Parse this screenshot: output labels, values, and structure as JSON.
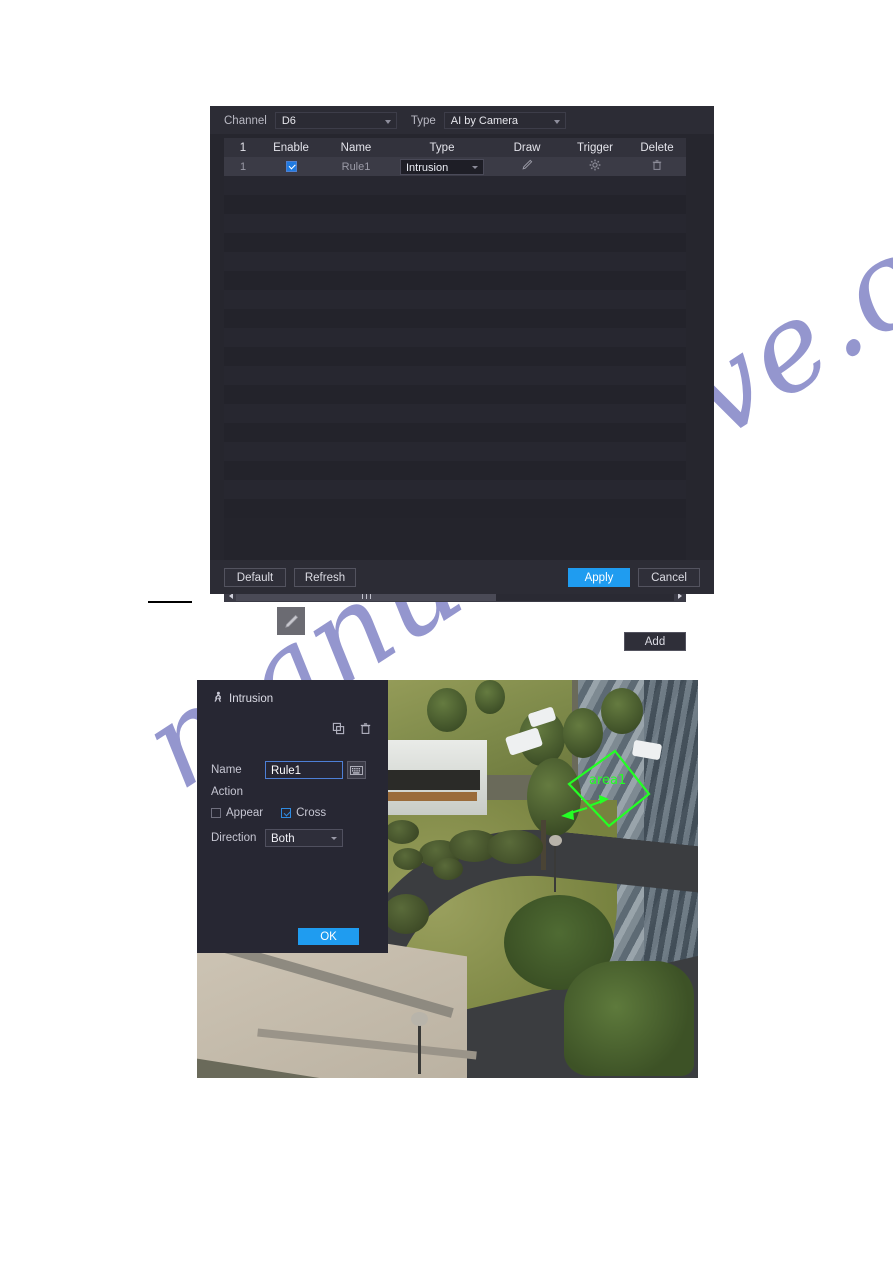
{
  "rule_dialog": {
    "filters": {
      "channel_label": "Channel",
      "channel_value": "D6",
      "type_label": "Type",
      "type_value": "AI by Camera"
    },
    "table": {
      "headers": [
        "1",
        "Enable",
        "Name",
        "Type",
        "Draw",
        "Trigger",
        "Delete"
      ],
      "rows": [
        {
          "index": "1",
          "enabled": true,
          "name": "Rule1",
          "type": "Intrusion",
          "draw_icon": "pencil-icon",
          "trigger_icon": "gear-icon",
          "delete_icon": "trash-icon"
        }
      ],
      "empty_row_count": 18
    },
    "add_label": "Add",
    "footer": {
      "default_label": "Default",
      "refresh_label": "Refresh",
      "apply_label": "Apply",
      "cancel_label": "Cancel"
    }
  },
  "inline_pencil": {
    "icon": "pencil-icon"
  },
  "intrusion_dialog": {
    "title": "Intrusion",
    "title_icon": "person-running-icon",
    "tools": [
      "copy-icon",
      "trash-icon"
    ],
    "name_label": "Name",
    "name_value": "Rule1",
    "keyboard_icon": "keyboard-icon",
    "action_label": "Action",
    "appear_label": "Appear",
    "appear_checked": false,
    "cross_label": "Cross",
    "cross_checked": true,
    "direction_label": "Direction",
    "direction_value": "Both",
    "ok_label": "OK"
  },
  "video_preview": {
    "area_label": "area1",
    "area_color": "#24ff24"
  },
  "watermark": {
    "text": "manualshive.com"
  },
  "colors": {
    "accent": "#1f9cf0",
    "dialog_bg": "#26262e",
    "panel_bg": "#272733",
    "row_selected": "#3b3b46"
  }
}
